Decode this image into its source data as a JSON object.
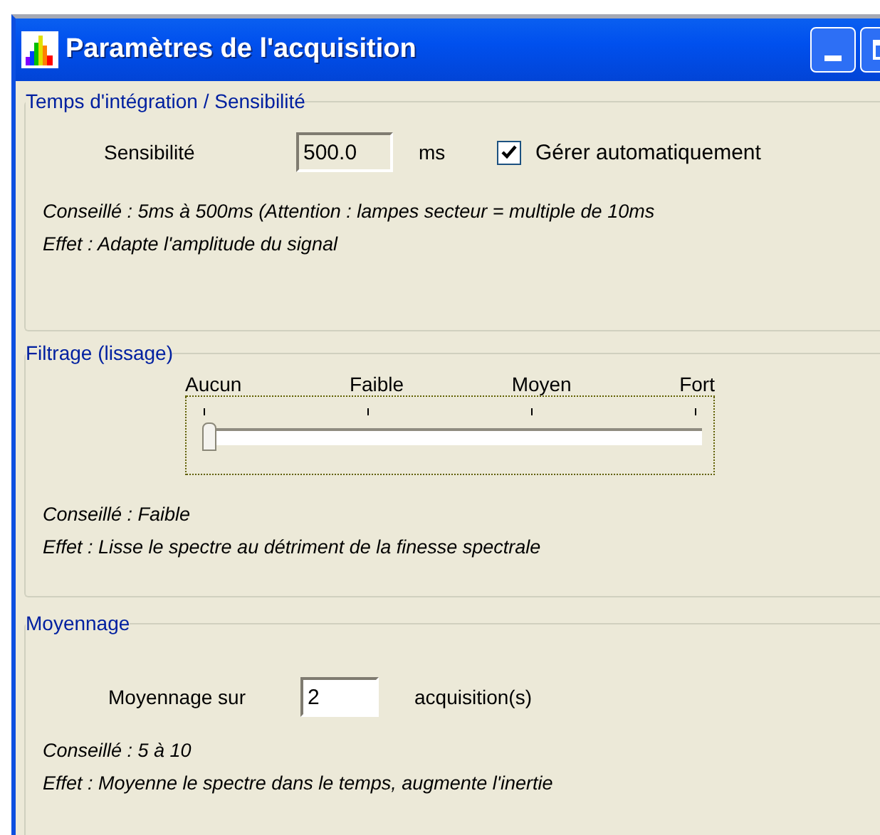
{
  "window": {
    "title": "Paramètres de l'acquisition"
  },
  "integration": {
    "legend": "Temps d'intégration / Sensibilité",
    "label": "Sensibilité",
    "field": {
      "value": "500.0",
      "disabled": true
    },
    "unit": "ms",
    "auto": {
      "label": "Gérer automatiquement",
      "checked": true
    },
    "notes": [
      "Conseillé : 5ms à 500ms (Attention : lampes secteur = multiple de 10ms",
      "Effet : Adapte l'amplitude du signal"
    ]
  },
  "filtering": {
    "legend": "Filtrage (lissage)",
    "ticks": [
      "Aucun",
      "Faible",
      "Moyen",
      "Fort"
    ],
    "slider": {
      "level": 0
    },
    "notes": [
      "Conseillé : Faible",
      "Effet : Lisse le spectre au détriment de la finesse spectrale"
    ]
  },
  "averaging": {
    "legend": "Moyennage",
    "label": "Moyennage sur",
    "field": {
      "value": "2"
    },
    "unit": "acquisition(s)",
    "notes": [
      "Conseillé : 5 à 10",
      "Effet : Moyenne le spectre dans le temps, augmente l'inertie"
    ]
  }
}
